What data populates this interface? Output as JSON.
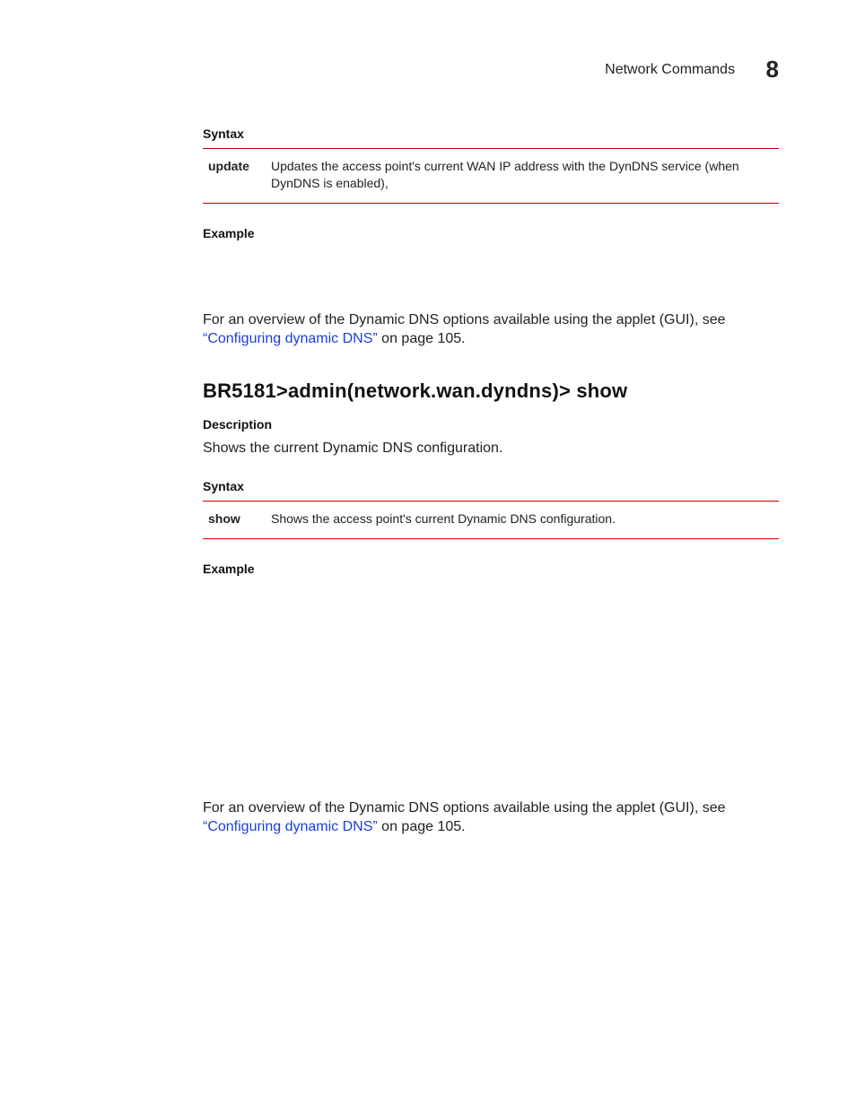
{
  "header": {
    "section_title": "Network Commands",
    "chapter_number": "8"
  },
  "section1": {
    "syntax_label": "Syntax",
    "cmd": "update",
    "cmd_desc": "Updates the access point's current WAN IP address with the DynDNS service (when DynDNS is enabled),",
    "example_label": "Example",
    "overview_pre": "For an overview of the Dynamic DNS options available using the applet (GUI), see ",
    "xref_text": "“Configuring dynamic DNS”",
    "overview_post": " on page 105."
  },
  "section2": {
    "title": "BR5181>admin(network.wan.dyndns)> show",
    "description_label": "Description",
    "description_text": "Shows the current Dynamic DNS configuration.",
    "syntax_label": "Syntax",
    "cmd": "show",
    "cmd_desc": "Shows the access point's current Dynamic DNS configuration.",
    "example_label": "Example",
    "overview_pre": "For an overview of the Dynamic DNS options available using the applet (GUI), see ",
    "xref_text": "“Configuring dynamic DNS”",
    "overview_post": " on page 105."
  }
}
